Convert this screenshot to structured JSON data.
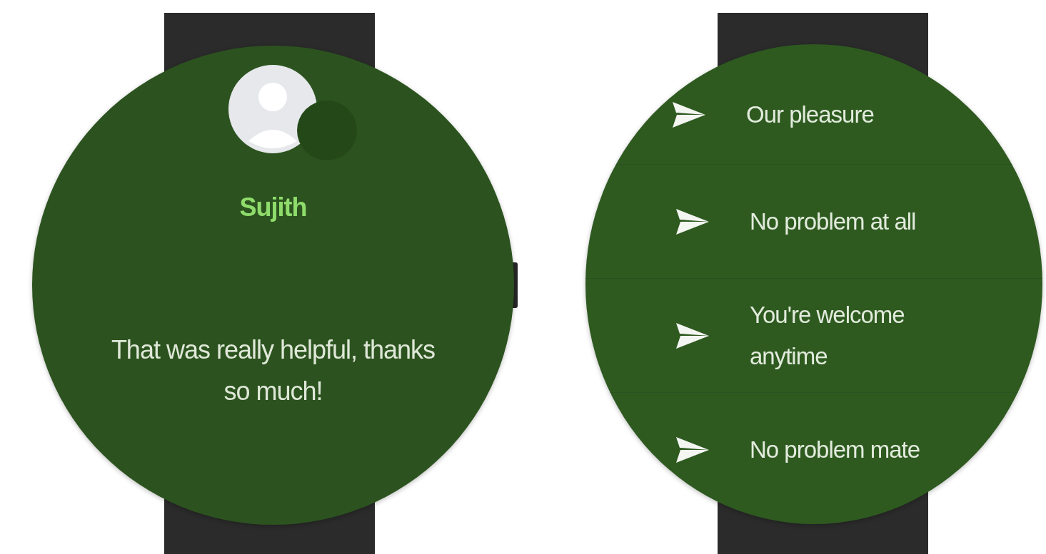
{
  "watches": [
    {
      "kind": "message",
      "contact": {
        "name": "Sujith"
      },
      "message": "That was really helpful, thanks so much!"
    },
    {
      "kind": "replies",
      "replies": [
        {
          "text": "Our pleasure"
        },
        {
          "text": "No problem at all"
        },
        {
          "text": "You're welcome anytime"
        },
        {
          "text": "No problem mate"
        }
      ]
    }
  ]
}
